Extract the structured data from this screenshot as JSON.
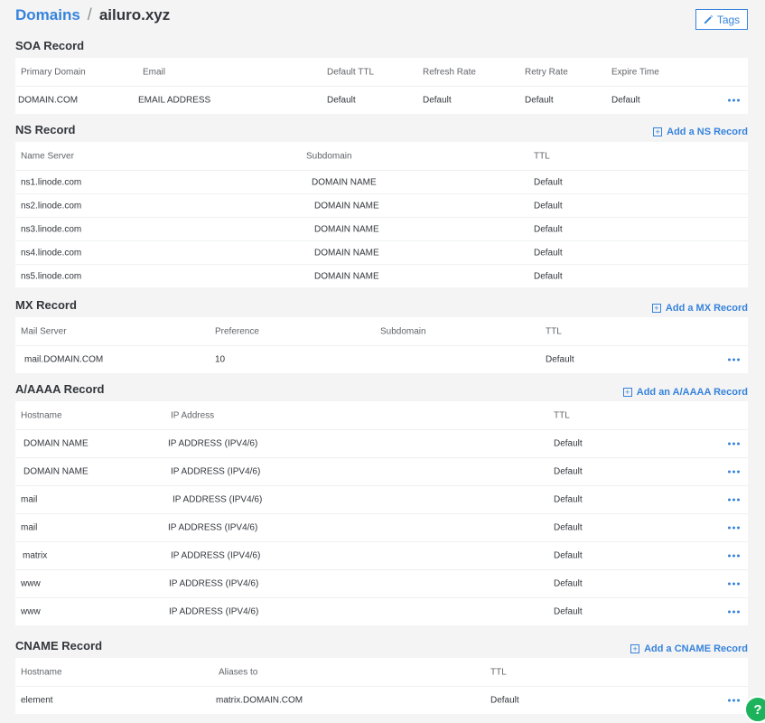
{
  "breadcrumb": {
    "parent": "Domains",
    "separator": "/",
    "current": "ailuro.xyz"
  },
  "tags_button": {
    "label": "Tags",
    "icon": "pencil-icon"
  },
  "soa": {
    "title": "SOA Record",
    "headers": [
      "Primary Domain",
      "Email",
      "Default TTL",
      "Refresh Rate",
      "Retry Rate",
      "Expire Time"
    ],
    "row": [
      "DOMAIN.COM",
      "EMAIL ADDRESS",
      "Default",
      "Default",
      "Default",
      "Default"
    ]
  },
  "ns": {
    "title": "NS Record",
    "add_label": "Add a NS Record",
    "headers": [
      "Name Server",
      "Subdomain",
      "TTL"
    ],
    "rows": [
      [
        "ns1.linode.com",
        "DOMAIN NAME",
        "Default"
      ],
      [
        "ns2.linode.com",
        "DOMAIN NAME",
        "Default"
      ],
      [
        "ns3.linode.com",
        "DOMAIN NAME",
        "Default"
      ],
      [
        "ns4.linode.com",
        "DOMAIN NAME",
        "Default"
      ],
      [
        "ns5.linode.com",
        "DOMAIN NAME",
        "Default"
      ]
    ]
  },
  "mx": {
    "title": "MX Record",
    "add_label": "Add a MX Record",
    "headers": [
      "Mail Server",
      "Preference",
      "Subdomain",
      "TTL"
    ],
    "rows": [
      [
        "mail.DOMAIN.COM",
        "10",
        "",
        "Default"
      ]
    ]
  },
  "a": {
    "title": "A/AAAA Record",
    "add_label": "Add an A/AAAA Record",
    "headers": [
      "Hostname",
      "IP Address",
      "TTL"
    ],
    "rows": [
      [
        "DOMAIN NAME",
        "IP ADDRESS (IPV4/6)",
        "Default"
      ],
      [
        "DOMAIN NAME",
        "IP ADDRESS (IPV4/6)",
        "Default"
      ],
      [
        "mail",
        "IP ADDRESS (IPV4/6)",
        "Default"
      ],
      [
        "mail",
        "IP ADDRESS (IPV4/6)",
        "Default"
      ],
      [
        "matrix",
        "IP ADDRESS (IPV4/6)",
        "Default"
      ],
      [
        "www",
        "IP ADDRESS (IPV4/6)",
        "Default"
      ],
      [
        "www",
        "IP ADDRESS (IPV4/6)",
        "Default"
      ]
    ]
  },
  "cname": {
    "title": "CNAME Record",
    "add_label": "Add a CNAME Record",
    "headers": [
      "Hostname",
      "Aliases to",
      "TTL"
    ],
    "rows": [
      [
        "element",
        "matrix.DOMAIN.COM",
        "Default"
      ]
    ]
  },
  "help": {
    "label": "?",
    "icon": "help-icon"
  },
  "colors": {
    "accent": "#3683dc",
    "help": "#1cb35c",
    "background": "#f4f4f4"
  }
}
